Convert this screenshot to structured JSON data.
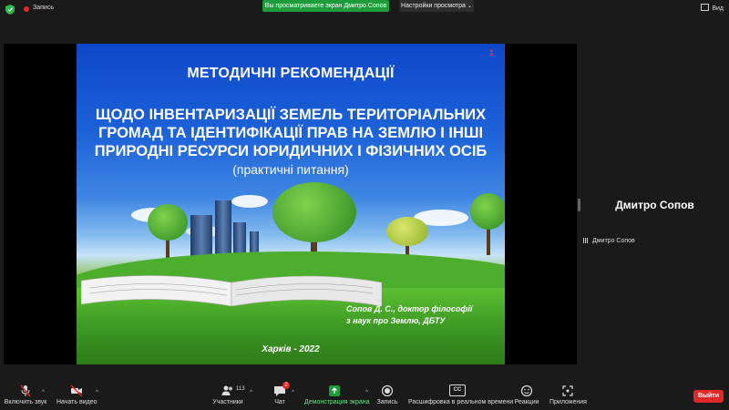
{
  "top_bar": {
    "record_label": "Запись",
    "share_banner": "Вы просматриваете экран Дмитро Сопов",
    "view_options": "Настройки просмотра",
    "view_label": "Вид"
  },
  "slide": {
    "number": "1",
    "title_line1": "МЕТОДИЧНІ РЕКОМЕНДАЦІЇ",
    "title_line2": "ЩОДО ІНВЕНТАРИЗАЦІЇ ЗЕМЕЛЬ ТЕРИТОРІАЛЬНИХ",
    "title_line3": "ГРОМАД ТА ІДЕНТИФІКАЦІЇ ПРАВ НА ЗЕМЛЮ І ІНШІ",
    "title_line4": "ПРИРОДНІ РЕСУРСИ ЮРИДИЧНИХ І ФІЗИЧНИХ ОСІБ",
    "subtitle": "(практичні питання)",
    "author_line1": "Сопов Д. С., доктор філософії",
    "author_line2": "з наук про Землю, ДБТУ",
    "city_year": "Харків - 2022"
  },
  "participant": {
    "name_large": "Дмитро Сопов",
    "name_small": "Дмитро Сопов"
  },
  "toolbar": {
    "audio": "Включить звук",
    "video": "Начать видео",
    "participants": "Участники",
    "participants_count": "113",
    "chat": "Чат",
    "chat_badge": "2",
    "share": "Демонстрация экрана",
    "record": "Запись",
    "captions": "Расшифровка в реальном времени",
    "captions_icon_text": "CC",
    "reactions": "Реакции",
    "apps": "Приложения",
    "leave": "Выйти"
  },
  "colors": {
    "accent_green": "#1e9c3c",
    "leave_red": "#e02828",
    "slide_blue": "#0d47c9"
  }
}
